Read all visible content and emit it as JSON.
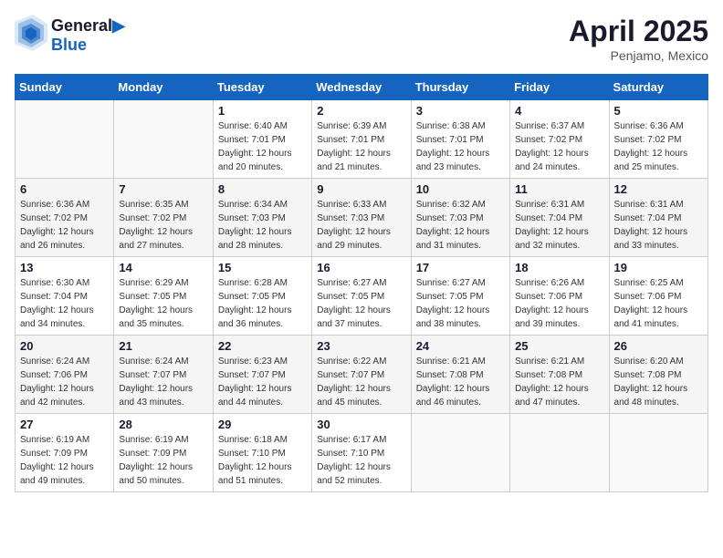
{
  "logo": {
    "line1": "General",
    "line2": "Blue"
  },
  "title": "April 2025",
  "subtitle": "Penjamo, Mexico",
  "days_header": [
    "Sunday",
    "Monday",
    "Tuesday",
    "Wednesday",
    "Thursday",
    "Friday",
    "Saturday"
  ],
  "weeks": [
    [
      {
        "day": "",
        "sunrise": "",
        "sunset": "",
        "daylight": ""
      },
      {
        "day": "",
        "sunrise": "",
        "sunset": "",
        "daylight": ""
      },
      {
        "day": "1",
        "sunrise": "Sunrise: 6:40 AM",
        "sunset": "Sunset: 7:01 PM",
        "daylight": "Daylight: 12 hours and 20 minutes."
      },
      {
        "day": "2",
        "sunrise": "Sunrise: 6:39 AM",
        "sunset": "Sunset: 7:01 PM",
        "daylight": "Daylight: 12 hours and 21 minutes."
      },
      {
        "day": "3",
        "sunrise": "Sunrise: 6:38 AM",
        "sunset": "Sunset: 7:01 PM",
        "daylight": "Daylight: 12 hours and 23 minutes."
      },
      {
        "day": "4",
        "sunrise": "Sunrise: 6:37 AM",
        "sunset": "Sunset: 7:02 PM",
        "daylight": "Daylight: 12 hours and 24 minutes."
      },
      {
        "day": "5",
        "sunrise": "Sunrise: 6:36 AM",
        "sunset": "Sunset: 7:02 PM",
        "daylight": "Daylight: 12 hours and 25 minutes."
      }
    ],
    [
      {
        "day": "6",
        "sunrise": "Sunrise: 6:36 AM",
        "sunset": "Sunset: 7:02 PM",
        "daylight": "Daylight: 12 hours and 26 minutes."
      },
      {
        "day": "7",
        "sunrise": "Sunrise: 6:35 AM",
        "sunset": "Sunset: 7:02 PM",
        "daylight": "Daylight: 12 hours and 27 minutes."
      },
      {
        "day": "8",
        "sunrise": "Sunrise: 6:34 AM",
        "sunset": "Sunset: 7:03 PM",
        "daylight": "Daylight: 12 hours and 28 minutes."
      },
      {
        "day": "9",
        "sunrise": "Sunrise: 6:33 AM",
        "sunset": "Sunset: 7:03 PM",
        "daylight": "Daylight: 12 hours and 29 minutes."
      },
      {
        "day": "10",
        "sunrise": "Sunrise: 6:32 AM",
        "sunset": "Sunset: 7:03 PM",
        "daylight": "Daylight: 12 hours and 31 minutes."
      },
      {
        "day": "11",
        "sunrise": "Sunrise: 6:31 AM",
        "sunset": "Sunset: 7:04 PM",
        "daylight": "Daylight: 12 hours and 32 minutes."
      },
      {
        "day": "12",
        "sunrise": "Sunrise: 6:31 AM",
        "sunset": "Sunset: 7:04 PM",
        "daylight": "Daylight: 12 hours and 33 minutes."
      }
    ],
    [
      {
        "day": "13",
        "sunrise": "Sunrise: 6:30 AM",
        "sunset": "Sunset: 7:04 PM",
        "daylight": "Daylight: 12 hours and 34 minutes."
      },
      {
        "day": "14",
        "sunrise": "Sunrise: 6:29 AM",
        "sunset": "Sunset: 7:05 PM",
        "daylight": "Daylight: 12 hours and 35 minutes."
      },
      {
        "day": "15",
        "sunrise": "Sunrise: 6:28 AM",
        "sunset": "Sunset: 7:05 PM",
        "daylight": "Daylight: 12 hours and 36 minutes."
      },
      {
        "day": "16",
        "sunrise": "Sunrise: 6:27 AM",
        "sunset": "Sunset: 7:05 PM",
        "daylight": "Daylight: 12 hours and 37 minutes."
      },
      {
        "day": "17",
        "sunrise": "Sunrise: 6:27 AM",
        "sunset": "Sunset: 7:05 PM",
        "daylight": "Daylight: 12 hours and 38 minutes."
      },
      {
        "day": "18",
        "sunrise": "Sunrise: 6:26 AM",
        "sunset": "Sunset: 7:06 PM",
        "daylight": "Daylight: 12 hours and 39 minutes."
      },
      {
        "day": "19",
        "sunrise": "Sunrise: 6:25 AM",
        "sunset": "Sunset: 7:06 PM",
        "daylight": "Daylight: 12 hours and 41 minutes."
      }
    ],
    [
      {
        "day": "20",
        "sunrise": "Sunrise: 6:24 AM",
        "sunset": "Sunset: 7:06 PM",
        "daylight": "Daylight: 12 hours and 42 minutes."
      },
      {
        "day": "21",
        "sunrise": "Sunrise: 6:24 AM",
        "sunset": "Sunset: 7:07 PM",
        "daylight": "Daylight: 12 hours and 43 minutes."
      },
      {
        "day": "22",
        "sunrise": "Sunrise: 6:23 AM",
        "sunset": "Sunset: 7:07 PM",
        "daylight": "Daylight: 12 hours and 44 minutes."
      },
      {
        "day": "23",
        "sunrise": "Sunrise: 6:22 AM",
        "sunset": "Sunset: 7:07 PM",
        "daylight": "Daylight: 12 hours and 45 minutes."
      },
      {
        "day": "24",
        "sunrise": "Sunrise: 6:21 AM",
        "sunset": "Sunset: 7:08 PM",
        "daylight": "Daylight: 12 hours and 46 minutes."
      },
      {
        "day": "25",
        "sunrise": "Sunrise: 6:21 AM",
        "sunset": "Sunset: 7:08 PM",
        "daylight": "Daylight: 12 hours and 47 minutes."
      },
      {
        "day": "26",
        "sunrise": "Sunrise: 6:20 AM",
        "sunset": "Sunset: 7:08 PM",
        "daylight": "Daylight: 12 hours and 48 minutes."
      }
    ],
    [
      {
        "day": "27",
        "sunrise": "Sunrise: 6:19 AM",
        "sunset": "Sunset: 7:09 PM",
        "daylight": "Daylight: 12 hours and 49 minutes."
      },
      {
        "day": "28",
        "sunrise": "Sunrise: 6:19 AM",
        "sunset": "Sunset: 7:09 PM",
        "daylight": "Daylight: 12 hours and 50 minutes."
      },
      {
        "day": "29",
        "sunrise": "Sunrise: 6:18 AM",
        "sunset": "Sunset: 7:10 PM",
        "daylight": "Daylight: 12 hours and 51 minutes."
      },
      {
        "day": "30",
        "sunrise": "Sunrise: 6:17 AM",
        "sunset": "Sunset: 7:10 PM",
        "daylight": "Daylight: 12 hours and 52 minutes."
      },
      {
        "day": "",
        "sunrise": "",
        "sunset": "",
        "daylight": ""
      },
      {
        "day": "",
        "sunrise": "",
        "sunset": "",
        "daylight": ""
      },
      {
        "day": "",
        "sunrise": "",
        "sunset": "",
        "daylight": ""
      }
    ]
  ]
}
